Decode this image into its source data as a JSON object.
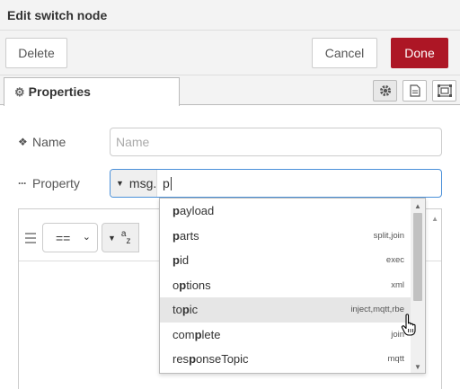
{
  "titlebar": {
    "title": "Edit switch node"
  },
  "toolbar": {
    "delete_label": "Delete",
    "cancel_label": "Cancel",
    "done_label": "Done"
  },
  "colors": {
    "done_bg": "#ad1625",
    "focus_border": "#4a90d9"
  },
  "tabs": {
    "properties_label": "Properties"
  },
  "form": {
    "name_label": "Name",
    "name_placeholder": "Name",
    "property_label": "Property",
    "property_type": "msg.",
    "property_value": "p"
  },
  "rule": {
    "operator": "==",
    "value_type_icon": "a-z"
  },
  "autocomplete": {
    "items": [
      {
        "prefix": "p",
        "rest": "ayload",
        "source": ""
      },
      {
        "prefix": "p",
        "rest": "arts",
        "source": "split,join"
      },
      {
        "prefix": "p",
        "rest": "id",
        "source": "exec"
      },
      {
        "prefix": "",
        "rest": "o",
        "mid": "p",
        "rest2": "tions",
        "source": "xml"
      },
      {
        "prefix": "",
        "rest": "to",
        "mid": "p",
        "rest2": "ic",
        "source": "inject,mqtt,rbe"
      },
      {
        "prefix": "",
        "rest": "com",
        "mid": "p",
        "rest2": "lete",
        "source": "join"
      },
      {
        "prefix": "",
        "rest": "res",
        "mid": "p",
        "rest2": "onseTopic",
        "source": "mqtt"
      }
    ]
  }
}
